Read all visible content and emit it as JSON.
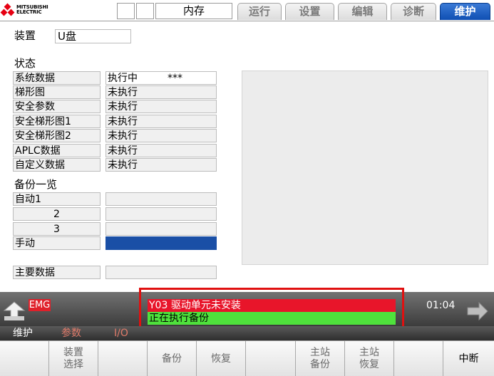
{
  "header": {
    "brand_line1": "MITSUBISHI",
    "brand_line2": "ELECTRIC",
    "mode": "内存",
    "tabs": [
      {
        "label": "运行",
        "active": false
      },
      {
        "label": "设置",
        "active": false
      },
      {
        "label": "编辑",
        "active": false
      },
      {
        "label": "诊断",
        "active": false
      },
      {
        "label": "维护",
        "active": true
      }
    ]
  },
  "device": {
    "label": "装置",
    "value": "U盘"
  },
  "status": {
    "title": "状态",
    "rows": [
      {
        "name": "系统数据",
        "value": "执行中",
        "extra": "***"
      },
      {
        "name": "梯形图",
        "value": "未执行"
      },
      {
        "name": "安全参数",
        "value": "未执行"
      },
      {
        "name": "安全梯形图1",
        "value": "未执行"
      },
      {
        "name": "安全梯形图2",
        "value": "未执行"
      },
      {
        "name": "APLC数据",
        "value": "未执行"
      },
      {
        "name": "自定义数据",
        "value": "未执行"
      }
    ]
  },
  "backup_list": {
    "title": "备份一览",
    "rows": [
      {
        "name": "自动1",
        "value": ""
      },
      {
        "name": "2",
        "value": ""
      },
      {
        "name": "3",
        "value": ""
      },
      {
        "name": "手动",
        "value": "",
        "selected": true
      }
    ]
  },
  "main_data": {
    "label": "主要数据",
    "value": ""
  },
  "messages": {
    "emg": "EMG",
    "alarm": "Y03  驱动单元未安装",
    "status": "正在执行备份",
    "clock": "01:04"
  },
  "menu_path": [
    {
      "label": "维护",
      "color": "#ffffff"
    },
    {
      "label": "参数",
      "color": "#e07b6a"
    },
    {
      "label": "I/O",
      "color": "#e07b6a"
    }
  ],
  "function_keys": [
    {
      "label": ""
    },
    {
      "label": "装置\n选择"
    },
    {
      "label": ""
    },
    {
      "label": "备份"
    },
    {
      "label": "恢复"
    },
    {
      "label": ""
    },
    {
      "label": "主站\n备份"
    },
    {
      "label": "主站\n恢复"
    },
    {
      "label": ""
    },
    {
      "label": "中断"
    }
  ],
  "colors": {
    "accent": "#0f4fb3",
    "alarm": "#e8152a",
    "ok": "#4fe23c",
    "selected_slot": "#1a4fa6",
    "callout": "#e01010"
  }
}
